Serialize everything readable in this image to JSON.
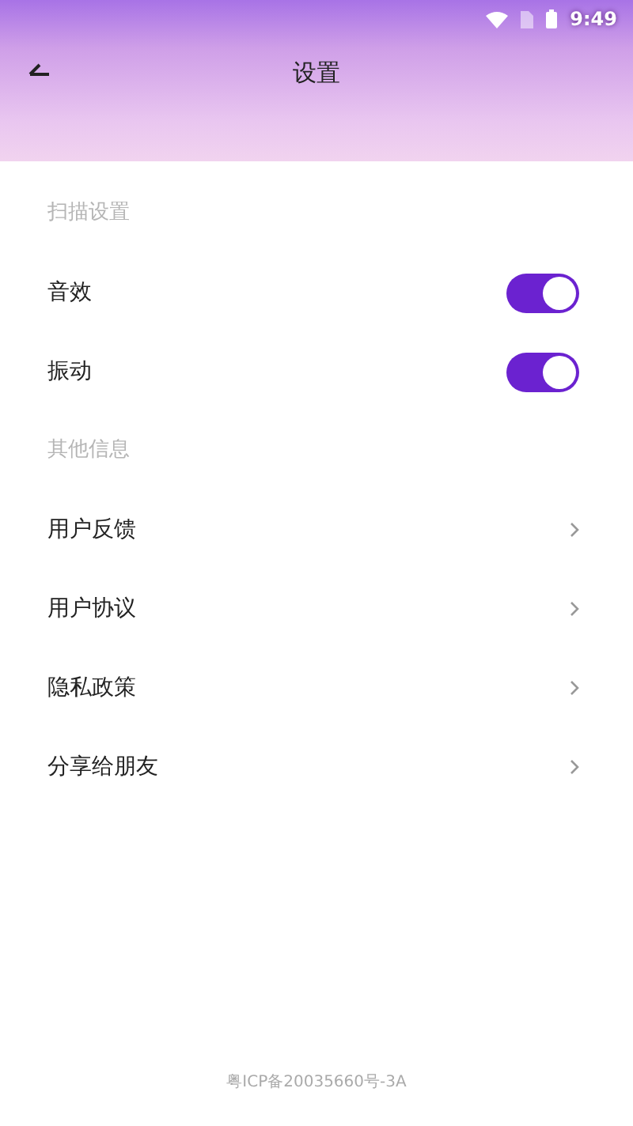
{
  "status_bar": {
    "time": "9:49"
  },
  "header": {
    "title": "设置"
  },
  "sections": [
    {
      "title": "扫描设置",
      "items": [
        {
          "kind": "toggle",
          "label": "音效",
          "on": true
        },
        {
          "kind": "toggle",
          "label": "振动",
          "on": true
        }
      ]
    },
    {
      "title": "其他信息",
      "items": [
        {
          "kind": "link",
          "label": "用户反馈"
        },
        {
          "kind": "link",
          "label": "用户协议"
        },
        {
          "kind": "link",
          "label": "隐私政策"
        },
        {
          "kind": "link",
          "label": "分享给朋友"
        }
      ]
    }
  ],
  "footer": {
    "text": "粤ICP备20035660号-3A"
  }
}
